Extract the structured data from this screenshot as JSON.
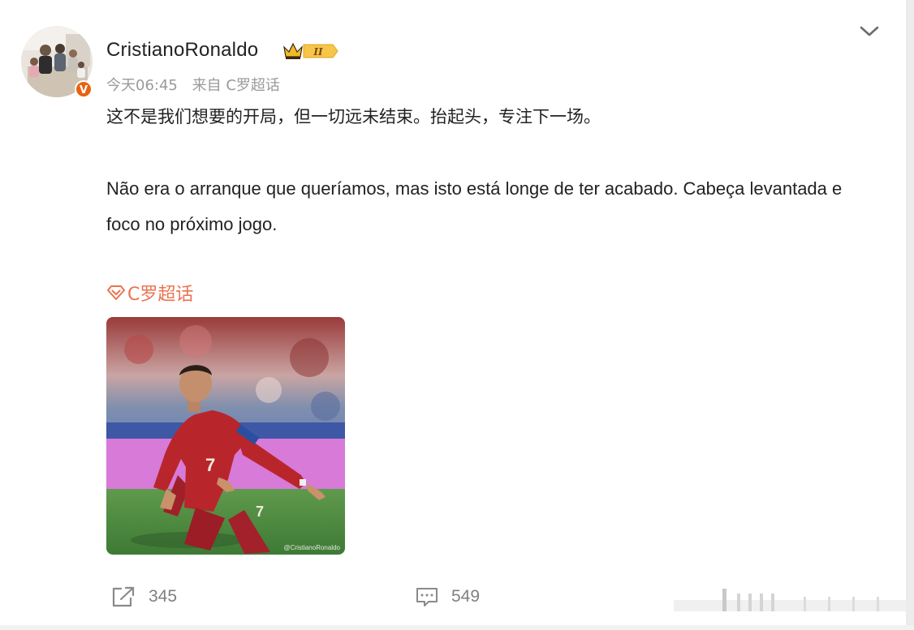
{
  "post": {
    "author": {
      "name": "CristianoRonaldo",
      "badge_letter": "V",
      "vip_level": "II"
    },
    "meta": {
      "time": "今天06:45",
      "source": "来自 C罗超话"
    },
    "text_cn": "这不是我们想要的开局，但一切远未结束。抬起头，专注下一场。",
    "text_pt": "Não era o arranque que queríamos, mas isto está longe de ter acabado. Cabeça levantada e foco no próximo jogo.",
    "topic": "C罗超话",
    "image": {
      "watermark": "@CristianoRonaldo",
      "jersey_number": "7"
    },
    "actions": {
      "repost_count": "345",
      "comment_count": "549"
    }
  },
  "colors": {
    "topic": "#eb7350",
    "meta": "#9a9a9a",
    "badge": "#e8620f",
    "jersey": "#b8262c"
  },
  "icons": [
    "verified-icon",
    "crown-icon",
    "chevron-down-icon",
    "topic-diamond-icon",
    "repost-icon",
    "comment-icon"
  ]
}
